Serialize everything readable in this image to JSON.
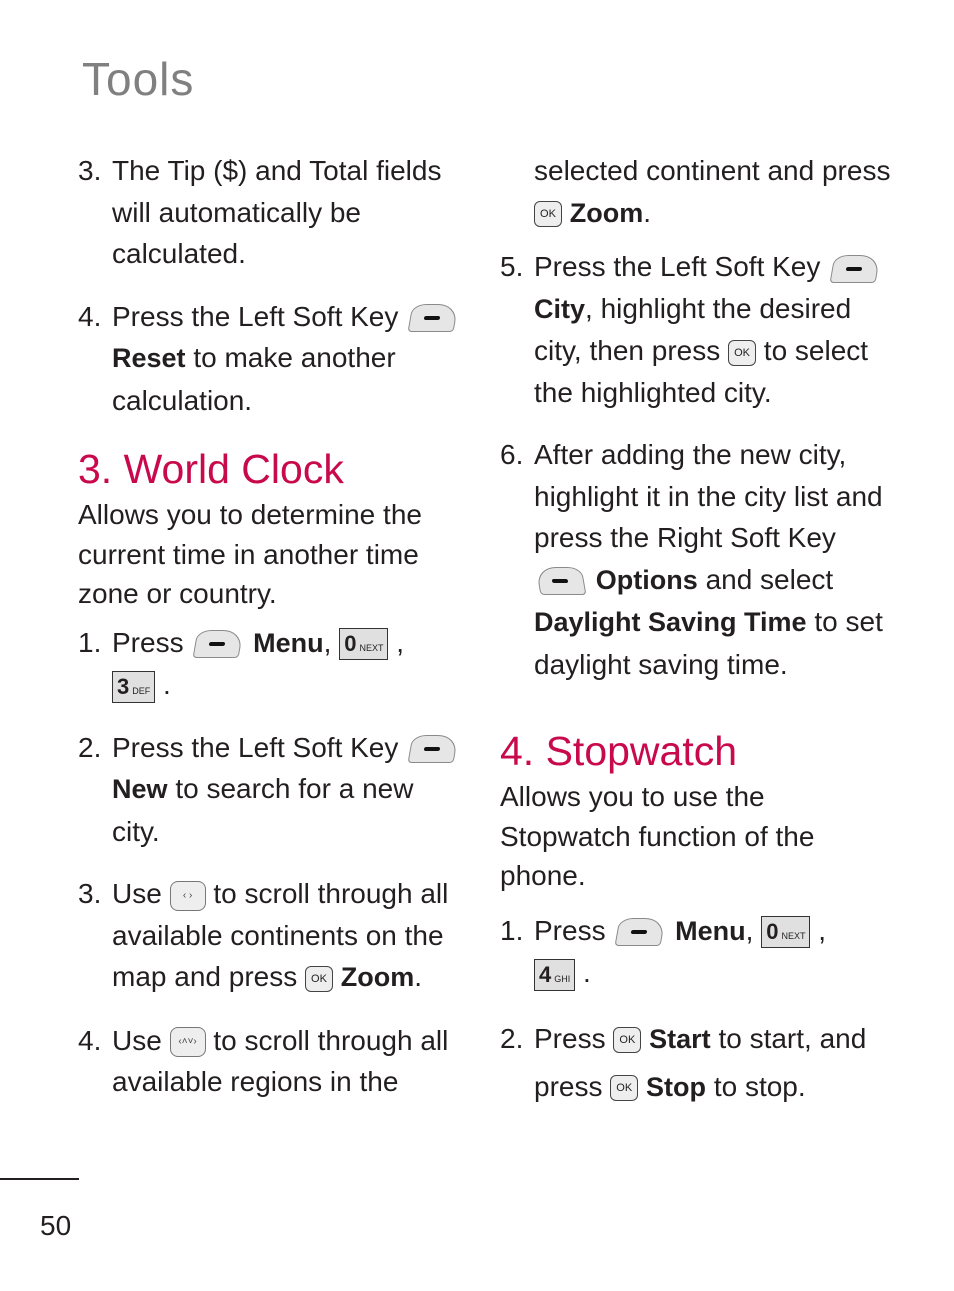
{
  "page": {
    "title": "Tools",
    "page_number": "50"
  },
  "left": {
    "intro_steps": [
      {
        "num": "3.",
        "text": "The Tip ($) and Total fields will automatically be calculated."
      },
      {
        "num": "4.",
        "pre": "Press the Left Soft Key",
        "key_label": "Reset",
        "post": "to make another calculation."
      }
    ],
    "world_clock": {
      "heading": "3. World Clock",
      "intro": "Allows you to determine the current time in another time zone or country.",
      "step1": {
        "num": "1.",
        "pre": "Press",
        "menu_label": "Menu",
        "next_key": "NEXT",
        "zero": "0",
        "digit_key": "3",
        "digit_letters": "DEF"
      },
      "step2": {
        "num": "2.",
        "pre": "Press the Left Soft Key",
        "key_label": "New",
        "post": "to search for a new city."
      },
      "step3": {
        "num": "3.",
        "pre": "Use",
        "mid": "to scroll through all available continents on the map and press",
        "ok": "OK",
        "action": "Zoom"
      },
      "step4": {
        "num": "4.",
        "pre": "Use",
        "post": "to scroll through all available regions in the"
      }
    }
  },
  "right": {
    "step4_cont": {
      "pre": "selected continent and press",
      "ok": "OK",
      "action": "Zoom"
    },
    "step5": {
      "num": "5.",
      "pre": "Press the Left Soft Key",
      "key_label": "City",
      "mid": ", highlight the desired city, then press",
      "ok": "OK",
      "post": "to select the highlighted city."
    },
    "step6": {
      "num": "6.",
      "pre": "After adding the new city, highlight it in the city list and press the Right Soft Key",
      "key_label": "Options",
      "mid": "and select",
      "key_label2": "Daylight Saving Time",
      "post": "to set daylight saving time."
    },
    "stopwatch": {
      "heading": "4. Stopwatch",
      "intro": "Allows you to use the Stopwatch function of the phone.",
      "step1": {
        "num": "1.",
        "pre": "Press",
        "menu_label": "Menu",
        "next_key": "NEXT",
        "zero": "0",
        "digit_key": "4",
        "digit_letters": "GHI"
      },
      "step2": {
        "num": "2.",
        "pre": "Press",
        "ok": "OK",
        "start_label": "Start",
        "mid": "to start, and press",
        "stop_label": "Stop",
        "post": "to stop."
      }
    }
  }
}
